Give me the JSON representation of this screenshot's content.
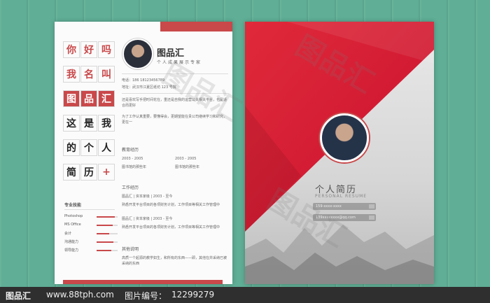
{
  "left": {
    "grid": [
      {
        "ch": "你",
        "red": true
      },
      {
        "ch": "好",
        "red": true
      },
      {
        "ch": "吗",
        "red": true
      },
      {
        "ch": "我",
        "red": true
      },
      {
        "ch": "名",
        "red": true
      },
      {
        "ch": "叫",
        "red": true
      },
      {
        "ch": "图",
        "inv": true
      },
      {
        "ch": "品",
        "inv": true
      },
      {
        "ch": "汇",
        "inv": true
      },
      {
        "ch": "这"
      },
      {
        "ch": "是"
      },
      {
        "ch": "我"
      },
      {
        "ch": "的"
      },
      {
        "ch": "个"
      },
      {
        "ch": "人"
      },
      {
        "ch": "简"
      },
      {
        "ch": "历"
      },
      {
        "ch": "+",
        "red": true
      }
    ],
    "brand": "图品汇",
    "tagline": "个人成果展示专家",
    "phone": "电话：186 18123456789",
    "address": "地址：武汉市江夏区纸坊 123 号院",
    "intro": "还是喜欢写手把时间花在，重还是自我的运营公关相关平台，也是适合而更好",
    "intro2": "为了工作认真重要，要懂得会，更期望能在贵公司继续学习和研究，更在一",
    "edu_head": "教育经历",
    "edu": [
      {
        "year": "2003 - 2005",
        "school": "图书馆的那些年"
      },
      {
        "year": "2003 - 2005",
        "school": "图书馆的那些年"
      }
    ],
    "work_head": "工作经历",
    "work": [
      {
        "title": "图品汇 | 资本家级 | 2003 - 至今",
        "desc": "熟悉开发平台项目的各项财务计划，工作项目等相关工作管理中"
      },
      {
        "title": "图品汇 | 资本家级 | 2003 - 至今",
        "desc": "熟悉开发平台项目的各项财务计划，工作项目等相关工作管理中"
      }
    ],
    "other_head": "其他说明",
    "other": "高质一个起源的教学如生，和所有的东西——即，其他在并采纳已被采纳的东西",
    "skills_head": "专业技能",
    "skills": [
      {
        "name": "Photoshop",
        "level": 0.85
      },
      {
        "name": "MS Office",
        "level": 0.75
      },
      {
        "name": "会计",
        "level": 0.6
      },
      {
        "name": "沟通能力",
        "level": 0.8
      },
      {
        "name": "领导能力",
        "level": 0.7
      }
    ]
  },
  "right": {
    "title": "个人简历",
    "subtitle": "PERSONAL RESUME",
    "phone": "159-xxxx-xxxx",
    "email": "139xxxxxxxx@qq.com"
  },
  "footer": {
    "brand": "图品汇",
    "url": "www.88tph.com",
    "id_label": "图片编号：",
    "id": "12299279"
  },
  "colors": {
    "accent": "#c9484a",
    "background": "#5fae95"
  }
}
